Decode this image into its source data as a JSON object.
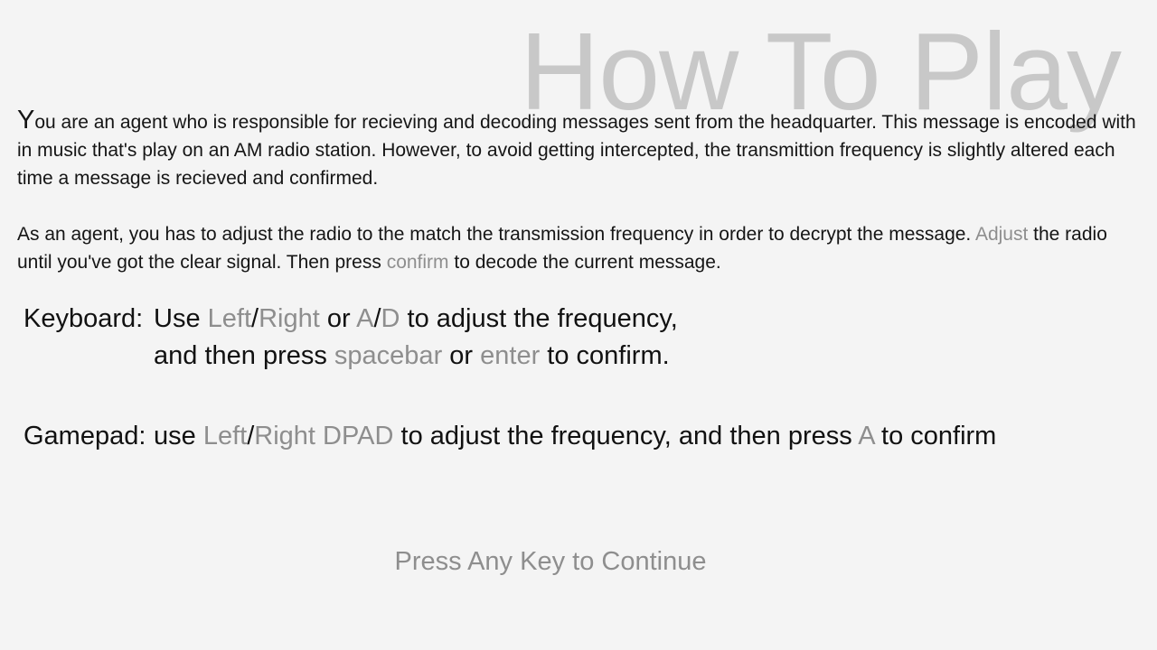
{
  "title": "How To Play",
  "intro": {
    "p1_dropcap": "Y",
    "p1_text": "ou are an agent who is responsible for recieving and decoding messages sent from the headquarter. This message is encoded with in music that's play on an AM radio station. However, to avoid getting intercepted, the transmittion frequency is slightly altered each time a message is recieved and confirmed.",
    "p2_a": "As an agent, you has to adjust the radio to the match the transmission frequency in order to decrypt the message. ",
    "p2_adjust": "Adjust",
    "p2_b": " the radio until you've got the clear signal. Then press ",
    "p2_confirm": "confirm",
    "p2_c": " to decode the current message."
  },
  "keyboard": {
    "label": "Keyboard: ",
    "l1_a": "Use ",
    "left": "Left",
    "slash1": "/",
    "right": "Right",
    "or1": " or ",
    "key_a": "A",
    "slash2": "/",
    "key_d": "D",
    "l1_b": " to adjust the frequency,",
    "l2_a": "and then press ",
    "spacebar": "spacebar",
    "or2": " or ",
    "enter": "enter",
    "l2_b": " to confirm."
  },
  "gamepad": {
    "label": "Gamepad: ",
    "a": "use ",
    "left": "Left",
    "slash": "/",
    "right_dpad": "Right DPAD",
    "b": " to adjust the frequency, and then press ",
    "key_a": "A",
    "c": " to confirm"
  },
  "continue_prompt": "Press Any Key to Continue",
  "colors": {
    "background": "#f4f4f4",
    "text": "#111111",
    "highlight": "#8e8e8e",
    "title": "#c8c8c8"
  }
}
